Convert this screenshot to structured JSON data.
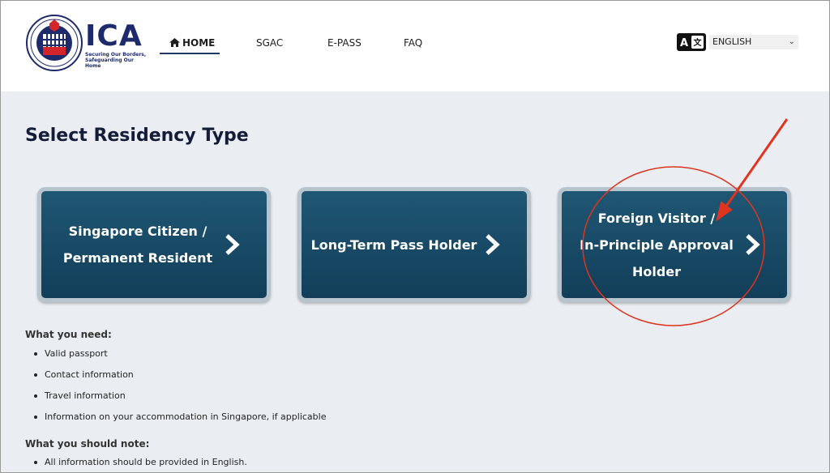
{
  "header": {
    "logo": {
      "title": "ICA",
      "tagline_line1": "Securing Our Borders,",
      "tagline_line2": "Safeguarding Our Home"
    },
    "nav": {
      "home": "HOME",
      "sgac": "SGAC",
      "epass": "E-PASS",
      "faq": "FAQ"
    },
    "language": {
      "selected": "ENGLISH",
      "icon": "translate-icon"
    }
  },
  "main": {
    "title": "Select Residency Type",
    "cards": [
      {
        "label": "Singapore Citizen /\nPermanent Resident"
      },
      {
        "label": "Long-Term Pass Holder"
      },
      {
        "label": "Foreign Visitor /\nIn-Principle Approval\nHolder"
      }
    ],
    "need": {
      "heading": "What you need:",
      "items": [
        "Valid passport",
        "Contact information",
        "Travel information",
        "Information on your accommodation in Singapore, if applicable"
      ]
    },
    "note": {
      "heading": "What you should note:",
      "items": [
        "All information should be provided in English."
      ]
    }
  },
  "colors": {
    "brand_navy": "#1d2a6b",
    "card_blue": "#1a4c68",
    "annotation_red": "#e0341e"
  }
}
